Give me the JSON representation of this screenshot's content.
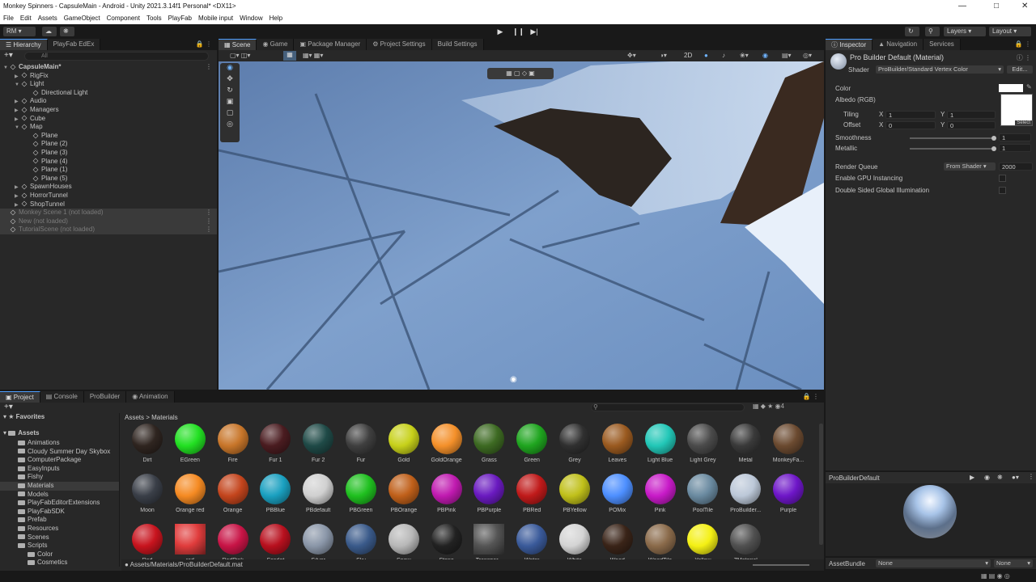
{
  "window": {
    "title": "Monkey Spinners - CapsuleMain - Android - Unity 2021.3.14f1 Personal* <DX11>"
  },
  "menu": [
    "File",
    "Edit",
    "Assets",
    "GameObject",
    "Component",
    "Tools",
    "PlayFab",
    "Mobile input",
    "Window",
    "Help"
  ],
  "toolbar": {
    "account": "RM",
    "layers": "Layers",
    "layout": "Layout"
  },
  "hierarchy": {
    "tab": "Hierarchy",
    "tab2": "PlayFab EdEx",
    "search_placeholder": "All",
    "items": [
      {
        "label": "CapsuleMain*",
        "depth": 0,
        "bold": true
      },
      {
        "label": "RigFix",
        "depth": 1
      },
      {
        "label": "Light",
        "depth": 1
      },
      {
        "label": "Directional Light",
        "depth": 2
      },
      {
        "label": "Audio",
        "depth": 1
      },
      {
        "label": "Managers",
        "depth": 1
      },
      {
        "label": "Cube",
        "depth": 1
      },
      {
        "label": "Map",
        "depth": 1
      },
      {
        "label": "Plane",
        "depth": 2
      },
      {
        "label": "Plane (2)",
        "depth": 2
      },
      {
        "label": "Plane (3)",
        "depth": 2
      },
      {
        "label": "Plane (4)",
        "depth": 2
      },
      {
        "label": "Plane (1)",
        "depth": 2
      },
      {
        "label": "Plane (5)",
        "depth": 2
      },
      {
        "label": "SpawnHouses",
        "depth": 1
      },
      {
        "label": "HorrorTunnel",
        "depth": 1
      },
      {
        "label": "ShopTunnel",
        "depth": 1
      },
      {
        "label": "Monkey Scene 1 (not loaded)",
        "depth": 0,
        "dim": true
      },
      {
        "label": "New (not loaded)",
        "depth": 0,
        "dim": true
      },
      {
        "label": "TutorialScene (not loaded)",
        "depth": 0,
        "dim": true
      }
    ]
  },
  "scene_tabs": [
    "Scene",
    "Game",
    "Package Manager",
    "Project Settings",
    "Build Settings"
  ],
  "scene_toolbar": {
    "mode2d": "2D"
  },
  "inspector": {
    "tabs": [
      "Inspector",
      "Navigation",
      "Services"
    ],
    "title": "Pro Builder Default (Material)",
    "shader_label": "Shader",
    "shader_value": "ProBuilder/Standard Vertex Color",
    "edit_label": "Edit...",
    "color_label": "Color",
    "albedo_label": "Albedo (RGB)",
    "tiling_label": "Tiling",
    "offset_label": "Offset",
    "tiling": {
      "x": "1",
      "y": "1"
    },
    "offset": {
      "x": "0",
      "y": "0"
    },
    "x_label": "X",
    "y_label": "Y",
    "select_label": "Select",
    "smoothness_label": "Smoothness",
    "smoothness": "1",
    "metallic_label": "Metallic",
    "metallic": "1",
    "render_queue_label": "Render Queue",
    "render_queue_mode": "From Shader",
    "render_queue_value": "2000",
    "gpu_instancing_label": "Enable GPU Instancing",
    "double_sided_label": "Double Sided Global Illumination",
    "preview_title": "ProBuilderDefault",
    "assetbundle_label": "AssetBundle",
    "assetbundle_value": "None",
    "assetbundle_variant": "None"
  },
  "project": {
    "tabs": [
      "Project",
      "Console",
      "ProBuilder",
      "Animation"
    ],
    "favorites": "Favorites",
    "assets_root": "Assets",
    "folders": [
      "Animations",
      "Cloudy Summer Day Skybox",
      "ComputerPackage",
      "EasyInputs",
      "Fishy",
      "Materials",
      "Models",
      "PlayFabEditorExtensions",
      "PlayFabSDK",
      "Prefab",
      "Resources",
      "Scenes",
      "Scripts",
      "Color",
      "Cosmetics"
    ],
    "breadcrumb": [
      "Assets",
      "Materials"
    ],
    "path": "Assets/Materials/ProBuilderDefault.mat",
    "materials_row1": [
      {
        "name": "Dirt",
        "color": "#2f2520"
      },
      {
        "name": "EGreen",
        "color": "#22e022"
      },
      {
        "name": "Fire",
        "color": "#c8762a"
      },
      {
        "name": "Fur 1",
        "color": "#4a1c20"
      },
      {
        "name": "Fur 2",
        "color": "#1f4a47"
      },
      {
        "name": "Fur",
        "color": "#3f3f3f"
      },
      {
        "name": "Gold",
        "color": "#c7d11a"
      },
      {
        "name": "GoldOrange",
        "color": "#f4902a"
      },
      {
        "name": "Grass",
        "color": "#3d6a22"
      },
      {
        "name": "Green",
        "color": "#1fa51f"
      },
      {
        "name": "Grey",
        "color": "#303030"
      },
      {
        "name": "Leaves",
        "color": "#9a5a20"
      },
      {
        "name": "Light Blue",
        "color": "#22c7b7"
      },
      {
        "name": "Light Grey",
        "color": "#4b4b4b"
      },
      {
        "name": "Metal",
        "color": "#3a3a3a"
      },
      {
        "name": "MonkeyFa...",
        "color": "#6b4a30"
      }
    ],
    "materials_row2": [
      {
        "name": "Moon",
        "color": "#3a3f48"
      },
      {
        "name": "Orange red",
        "color": "#f58a22"
      },
      {
        "name": "Orange",
        "color": "#c4451d"
      },
      {
        "name": "PBBlue",
        "color": "#1aa0c0"
      },
      {
        "name": "PBdefault",
        "color": "#d0d0d0"
      },
      {
        "name": "PBGreen",
        "color": "#1fc01f"
      },
      {
        "name": "PBOrange",
        "color": "#c0601a"
      },
      {
        "name": "PBPink",
        "color": "#c01ab0"
      },
      {
        "name": "PBPurple",
        "color": "#6a1ac0"
      },
      {
        "name": "PBRed",
        "color": "#c01a1a"
      },
      {
        "name": "PBYellow",
        "color": "#c0c01a"
      },
      {
        "name": "POMix",
        "color": "#4d8fff"
      },
      {
        "name": "Pink",
        "color": "#c81ac8"
      },
      {
        "name": "PoolTile",
        "color": "#6a8aa0"
      },
      {
        "name": "ProBuilder...",
        "color": "#bcc8d8"
      },
      {
        "name": "Purple",
        "color": "#6e16c8"
      }
    ],
    "materials_row3": [
      {
        "name": "Red",
        "color": "#c8141e"
      },
      {
        "name": "red",
        "color": "#e03c3c"
      },
      {
        "name": "RedPink",
        "color": "#c81446"
      },
      {
        "name": "Scarlet",
        "color": "#b8101e"
      },
      {
        "name": "Silver",
        "color": "#8a96a8"
      },
      {
        "name": "Sky",
        "color": "#3a5a8a"
      },
      {
        "name": "Snow",
        "color": "#b8b8b8"
      },
      {
        "name": "Stone",
        "color": "#222222"
      },
      {
        "name": "Transpar...",
        "color": "#555555"
      },
      {
        "name": "Water",
        "color": "#3a5a9a"
      },
      {
        "name": "White",
        "color": "#d4d4d4"
      },
      {
        "name": "Wood",
        "color": "#3a2418"
      },
      {
        "name": "WoodTile",
        "color": "#8a6a4a"
      },
      {
        "name": "Yellow",
        "color": "#f4f014"
      },
      {
        "name": "ZMaterial",
        "color": "#505050"
      }
    ]
  }
}
